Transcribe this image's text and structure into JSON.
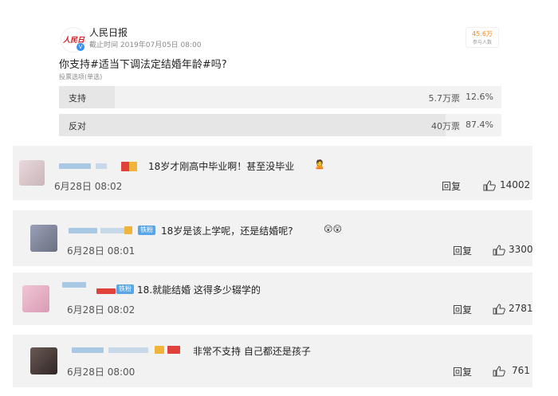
{
  "poll": {
    "author": "人民日报",
    "logo_text": "人民日報",
    "deadline": "截止时间 2019年07月05日 08:00",
    "participants": {
      "number": "45.6万",
      "label": "参与人数"
    },
    "question": "你支持#适当下调法定结婚年龄#吗?",
    "option_type": "投票选项(单选)",
    "options": [
      {
        "label": "支持",
        "votes": "5.7万票",
        "percent": "12.6%",
        "share": 0.126
      },
      {
        "label": "反对",
        "votes": "40万票",
        "percent": "87.4%",
        "share": 0.874
      }
    ]
  },
  "comments": [
    {
      "text": "18岁才刚高中毕业啊！甚至没毕业",
      "emoji": "🙎",
      "date": "6月28日 08:02",
      "reply": "回复",
      "likes": "14002"
    },
    {
      "fan_badge": "铁粉",
      "text": "18岁是该上学呢，还是结婚呢?",
      "emoji": "😲😲",
      "date": "6月28日 08:01",
      "reply": "回复",
      "likes": "3300"
    },
    {
      "fan_badge": "铁粉",
      "text": "18.就能结婚  这得多少辍学的",
      "date": "6月28日 08:02",
      "reply": "回复",
      "likes": "2781"
    },
    {
      "text": "非常不支持 自己都还是孩子",
      "date": "6月28日 08:00",
      "reply": "回复",
      "likes": "761"
    }
  ],
  "colors": {
    "accent": "#f08a24",
    "verified": "#3a8ff2",
    "fan_badge": "#58a6e6"
  },
  "icons": {
    "like": "thumbs-up-icon",
    "verified": "verified-badge-icon"
  }
}
